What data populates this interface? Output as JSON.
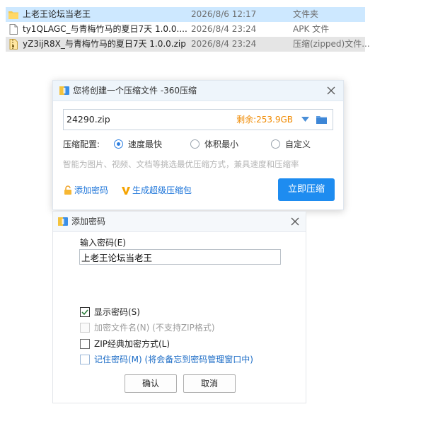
{
  "files": [
    {
      "name": "上老王论坛当老王",
      "date": "2026/8/6 12:17",
      "type": "文件夹",
      "icon": "folder-icon"
    },
    {
      "name": "ty1QLAGC_与青梅竹马的夏日7天 1.0.0....",
      "date": "2026/8/4 23:24",
      "type": "APK 文件",
      "icon": "document-icon"
    },
    {
      "name": "yZ3ijR8X_与青梅竹马的夏日7天 1.0.0.zip",
      "date": "2026/8/4 23:24",
      "type": "压缩(zipped)文件...",
      "icon": "zip-file-icon"
    }
  ],
  "zip_dialog": {
    "title": "您将创建一个压缩文件 -360压缩",
    "filename": "24290.zip",
    "free_space": "剩余:253.9GB",
    "config_label": "压缩配置:",
    "options": [
      "速度最快",
      "体积最小",
      "自定义"
    ],
    "selected_option": "速度最快",
    "hint": "智能为图片、视频、文档等挑选最优压缩方式，兼具速度和压缩率",
    "add_password": "添加密码",
    "super_pack": "生成超级压缩包",
    "compress_button": "立即压缩",
    "accent_color": "#1e8cf0",
    "free_color": "#f08a00"
  },
  "password_dialog": {
    "title": "添加密码",
    "input_label": "输入密码(E)",
    "password_value": "上老王论坛当老王",
    "checkboxes": [
      {
        "label": "显示密码(S)",
        "checked": true,
        "enabled": true
      },
      {
        "label": "加密文件名(N) (不支持ZIP格式)",
        "checked": false,
        "enabled": false
      },
      {
        "label": "ZIP经典加密方式(L)",
        "checked": false,
        "enabled": true
      },
      {
        "label": "记住密码(M) (将会备忘到密码管理窗口中)",
        "checked": false,
        "enabled": true
      }
    ],
    "ok_label": "确认",
    "cancel_label": "取消"
  }
}
